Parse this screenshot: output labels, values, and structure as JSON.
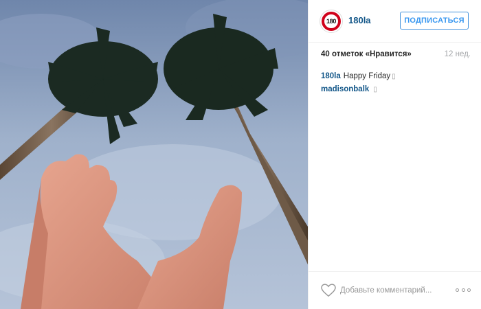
{
  "post": {
    "author": {
      "username": "180la",
      "avatar_text": "180"
    },
    "follow_label": "ПОДПИСАТЬСЯ",
    "likes_text": "40 отметок «Нравится»",
    "time_ago": "12 нед.",
    "comments": [
      {
        "author": "180la",
        "text": "Happy Friday",
        "emoji": "▯"
      },
      {
        "author": "madisonbalk",
        "text": "",
        "emoji": "▯"
      }
    ],
    "comment_placeholder": "Добавьте комментарий...",
    "colors": {
      "link": "#125688",
      "follow_blue": "#3897f0",
      "avatar_ring": "#d0021b"
    },
    "icons": [
      "heart-icon",
      "more-options-icon"
    ]
  }
}
